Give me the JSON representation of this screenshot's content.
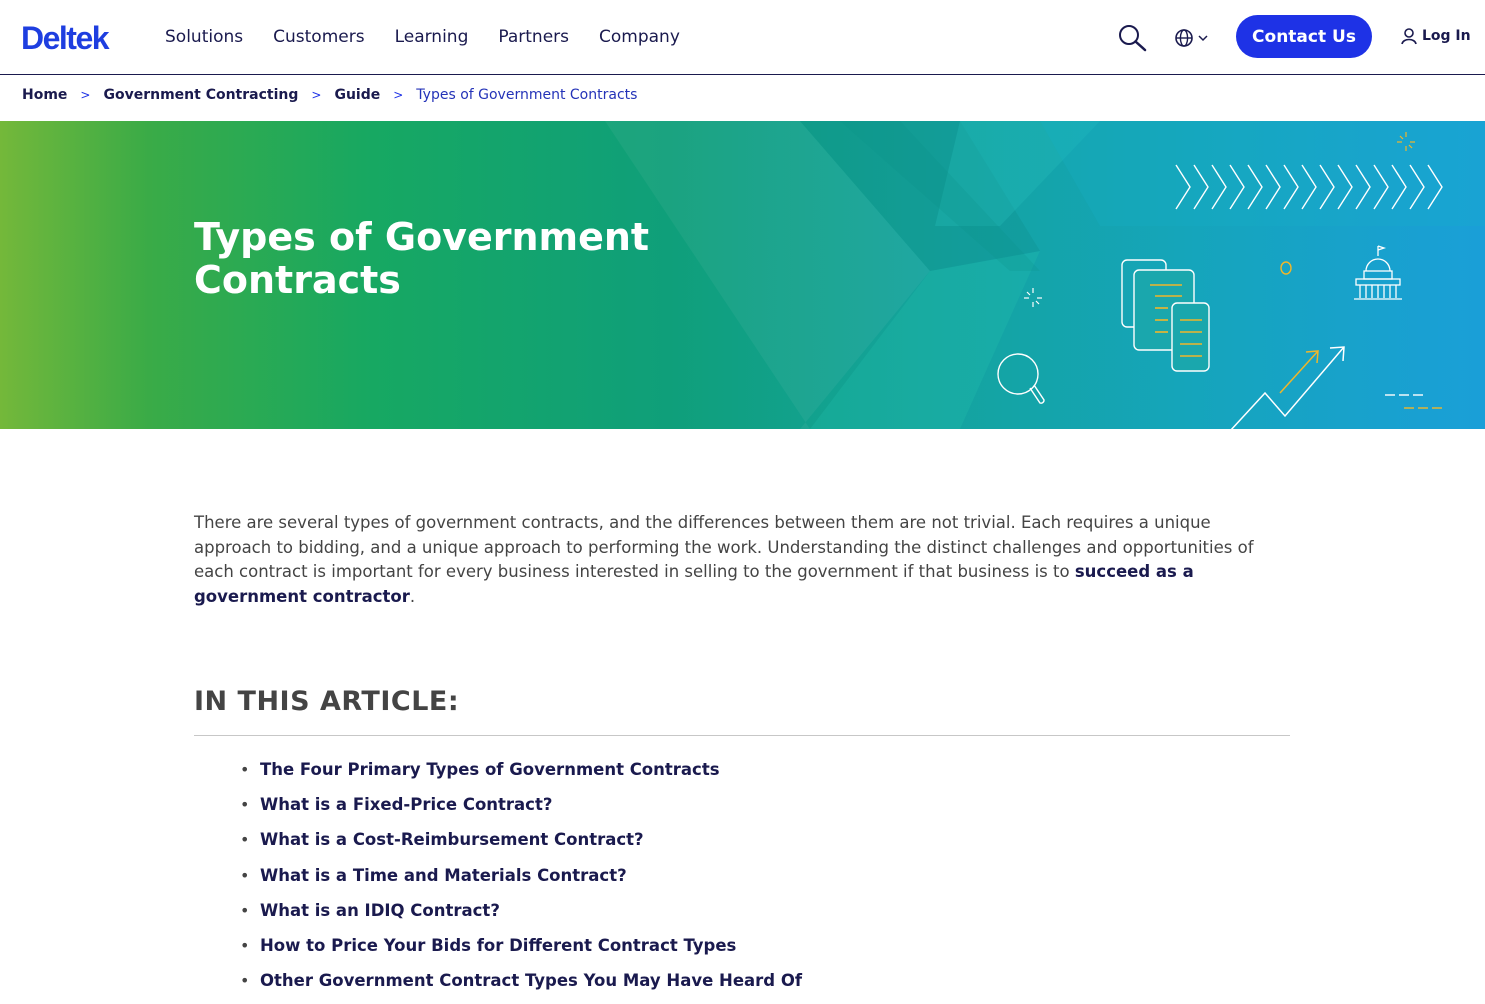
{
  "brand": {
    "logo_text": "Deltek",
    "accent": "#1e32e6",
    "navy": "#1a1a4e"
  },
  "nav": {
    "items": [
      "Solutions",
      "Customers",
      "Learning",
      "Partners",
      "Company"
    ],
    "contact_label": "Contact Us",
    "login_label": "Log In"
  },
  "breadcrumb": {
    "items": [
      "Home",
      "Government Contracting",
      "Guide"
    ],
    "separator": ">",
    "current": "Types of Government Contracts"
  },
  "hero": {
    "title": "Types of Government Contracts",
    "illustration_icons": [
      "chevrons-pattern",
      "document-stack-icon",
      "capitol-building-icon",
      "magnifier-icon",
      "growth-arrow-icon",
      "sparkle-icon"
    ]
  },
  "intro": {
    "text_before_link": "There are several types of government contracts, and the differences between them are not trivial. Each requires a unique approach to bidding, and a unique approach to performing the work. Understanding the distinct challenges and opportunities of each contract is important for every business interested in selling to the government if that business is to ",
    "link_text": "succeed as a government contractor",
    "text_after_link": "."
  },
  "toc": {
    "heading": "IN THIS ARTICLE:",
    "items": [
      "The Four Primary Types of Government Contracts",
      "What is a Fixed-Price Contract?",
      "What is a Cost-Reimbursement Contract?",
      "What is a Time and Materials Contract?",
      "What is an IDIQ Contract?",
      "How to Price Your Bids for Different Contract Types",
      "Other Government Contract Types You May Have Heard Of"
    ]
  }
}
